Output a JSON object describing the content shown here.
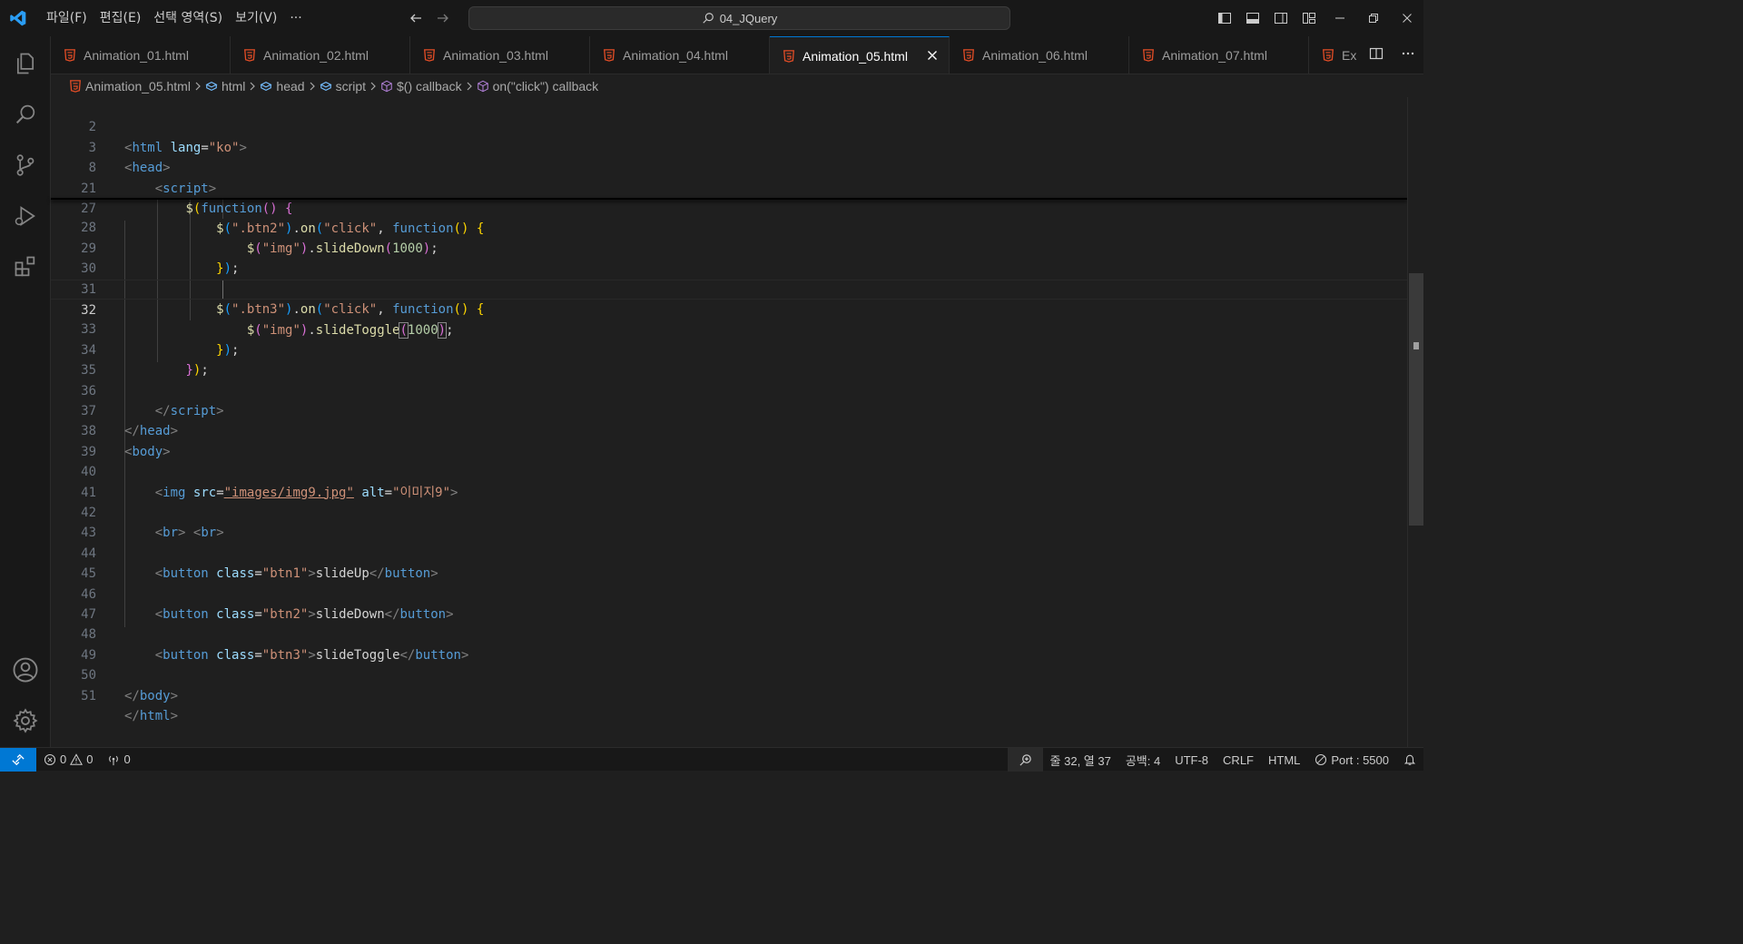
{
  "menu": [
    "파일(F)",
    "편집(E)",
    "선택 영역(S)",
    "보기(V)"
  ],
  "menu_more": "···",
  "command_center": {
    "text": "04_JQuery"
  },
  "tabs": [
    {
      "label": "Animation_01.html"
    },
    {
      "label": "Animation_02.html"
    },
    {
      "label": "Animation_03.html"
    },
    {
      "label": "Animation_04.html"
    },
    {
      "label": "Animation_05.html",
      "active": true
    },
    {
      "label": "Animation_06.html"
    },
    {
      "label": "Animation_07.html"
    },
    {
      "label": "Ex"
    }
  ],
  "breadcrumb": [
    "Animation_05.html",
    "html",
    "head",
    "script",
    "$() callback",
    "on(\"click\") callback"
  ],
  "lines": [
    {
      "n": "2"
    },
    {
      "n": "3"
    },
    {
      "n": "8"
    },
    {
      "n": "21"
    },
    {
      "n": "27"
    },
    {
      "n": "28"
    },
    {
      "n": "29"
    },
    {
      "n": "30"
    },
    {
      "n": "31"
    },
    {
      "n": "32"
    },
    {
      "n": "33"
    },
    {
      "n": "34"
    },
    {
      "n": "35"
    },
    {
      "n": "36"
    },
    {
      "n": "37"
    },
    {
      "n": "38"
    },
    {
      "n": "39"
    },
    {
      "n": "40"
    },
    {
      "n": "41"
    },
    {
      "n": "42"
    },
    {
      "n": "43"
    },
    {
      "n": "44"
    },
    {
      "n": "45"
    },
    {
      "n": "46"
    },
    {
      "n": "47"
    },
    {
      "n": "48"
    },
    {
      "n": "49"
    },
    {
      "n": "50"
    },
    {
      "n": "51"
    }
  ],
  "code": {
    "l2": {
      "tag": "html",
      "attr": "lang",
      "val": "\"ko\""
    },
    "l3": {
      "tag": "head"
    },
    "l8": {
      "tag": "script"
    },
    "l21": {
      "fn": "$",
      "kw": "function"
    },
    "l27": {
      "sel": "\".btn2\"",
      "method": "on",
      "evt": "\"click\"",
      "kw": "function"
    },
    "l28": {
      "sel": "\"img\"",
      "method": "slideDown",
      "num": "1000"
    },
    "l31": {
      "sel": "\".btn3\"",
      "method": "on",
      "evt": "\"click\"",
      "kw": "function"
    },
    "l32": {
      "sel": "\"img\"",
      "method": "slideToggle",
      "num": "1000"
    },
    "l36": {
      "tag": "script"
    },
    "l37": {
      "tag": "head"
    },
    "l38": {
      "tag": "body"
    },
    "l40": {
      "tag": "img",
      "attr1": "src",
      "val1": "\"images/img9.jpg\"",
      "attr2": "alt",
      "val2": "\"이미지9\""
    },
    "l42": {
      "tag": "br"
    },
    "l44": {
      "tag": "button",
      "attr": "class",
      "val": "\"btn1\"",
      "text": "slideUp"
    },
    "l46": {
      "tag": "button",
      "attr": "class",
      "val": "\"btn2\"",
      "text": "slideDown"
    },
    "l48": {
      "tag": "button",
      "attr": "class",
      "val": "\"btn3\"",
      "text": "slideToggle"
    },
    "l50": {
      "tag": "body"
    },
    "l51": {
      "tag": "html"
    }
  },
  "status": {
    "errors": "0",
    "warnings": "0",
    "ports": "0",
    "position": "줄 32, 열 37",
    "spaces": "공백: 4",
    "encoding": "UTF-8",
    "eol": "CRLF",
    "language": "HTML",
    "port": "Port : 5500"
  },
  "colors": {
    "accent": "#0078d4",
    "html_icon": "#e44d26",
    "background": "#1f1f1f"
  }
}
